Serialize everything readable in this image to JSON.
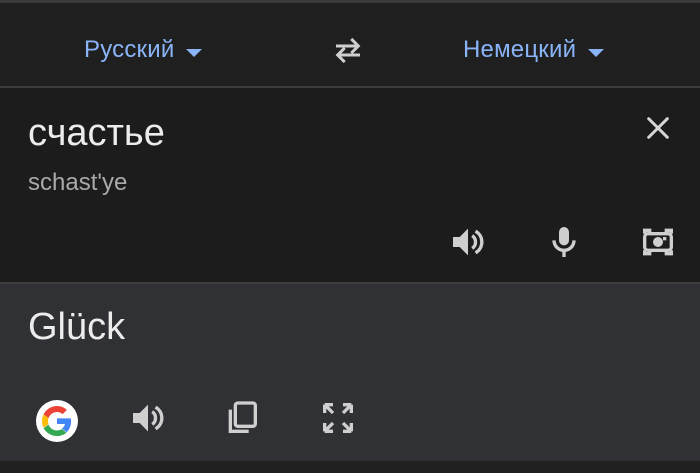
{
  "languages": {
    "source": "Русский",
    "target": "Немецкий"
  },
  "source": {
    "text": "счастье",
    "transliteration": "schast'ye"
  },
  "translation": {
    "text": "Glück"
  },
  "icons": {
    "swap": "swap-languages-icon",
    "clear": "close-icon",
    "listen": "speaker-icon",
    "mic": "microphone-icon",
    "camera": "camera-icon",
    "google": "google-logo-icon",
    "copy": "copy-icon",
    "fullscreen": "fullscreen-icon"
  },
  "colors": {
    "accent": "#8ab4f8",
    "background": "#1f1f1f",
    "translation_panel": "#303134"
  }
}
